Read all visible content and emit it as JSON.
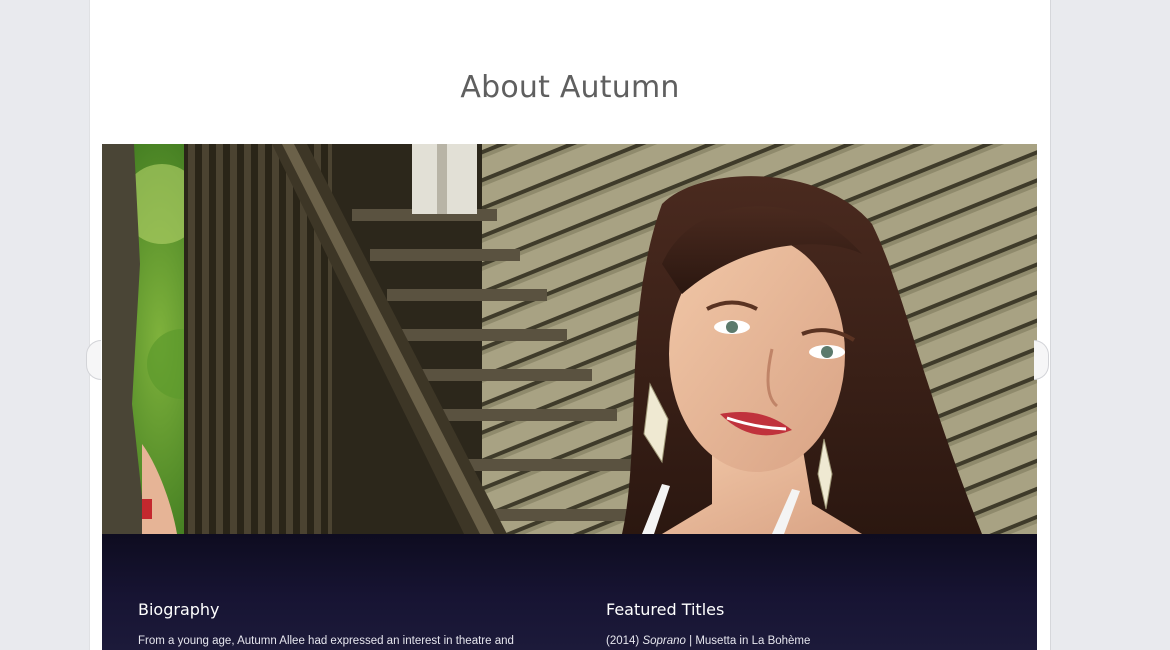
{
  "page": {
    "title": "About Autumn"
  },
  "hero": {
    "alt": "Portrait photo of Autumn on a wooden staircase"
  },
  "carousel": {
    "prev_icon": "chevron-left-icon",
    "next_icon": "chevron-right-icon"
  },
  "biography": {
    "heading": "Biography",
    "text": "From a young age, Autumn Allee had expressed an interest in theatre and"
  },
  "featured": {
    "heading": "Featured Titles",
    "year": "(2014)",
    "role_type": "Soprano",
    "separator": " | ",
    "role": "Musetta in La Bohème"
  },
  "colors": {
    "background": "#e9eaee",
    "page": "#ffffff",
    "title": "#5f5f5f",
    "info_panel": "#171433"
  }
}
